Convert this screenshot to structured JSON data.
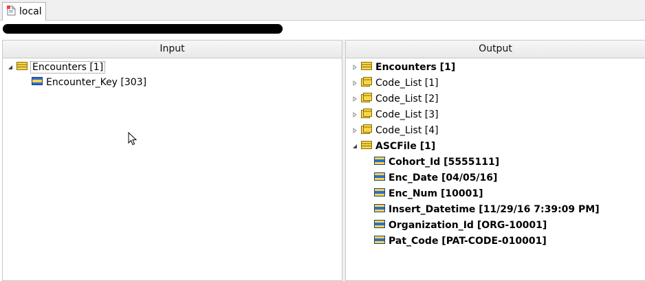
{
  "tab": {
    "label": "local",
    "icon": "document-icon"
  },
  "input_panel": {
    "header": "Input",
    "root": {
      "label": "Encounters [1]"
    },
    "children": [
      {
        "label": "Encounter_Key [303]"
      }
    ]
  },
  "output_panel": {
    "header": "Output",
    "items": [
      {
        "label": "Encounters [1]",
        "bold": true,
        "expanded": false
      },
      {
        "label": "Code_List [1]",
        "bold": false,
        "expanded": false
      },
      {
        "label": "Code_List [2]",
        "bold": false,
        "expanded": false
      },
      {
        "label": "Code_List [3]",
        "bold": false,
        "expanded": false
      },
      {
        "label": "Code_List [4]",
        "bold": false,
        "expanded": false
      },
      {
        "label": "ASCFile [1]",
        "bold": true,
        "expanded": true
      }
    ],
    "ascfile_fields": [
      {
        "label": "Cohort_Id [5555111]"
      },
      {
        "label": "Enc_Date [04/05/16]"
      },
      {
        "label": "Enc_Num [10001]"
      },
      {
        "label": "Insert_Datetime [11/29/16 7:39:09 PM]"
      },
      {
        "label": "Organization_Id [ORG-10001]"
      },
      {
        "label": "Pat_Code [PAT-CODE-010001]"
      }
    ]
  },
  "colors": {
    "folder": "#f5d64c",
    "field_blue": "#2f6bd1",
    "field_yellow": "#f5d64c",
    "accent": "#3c7fb1"
  }
}
